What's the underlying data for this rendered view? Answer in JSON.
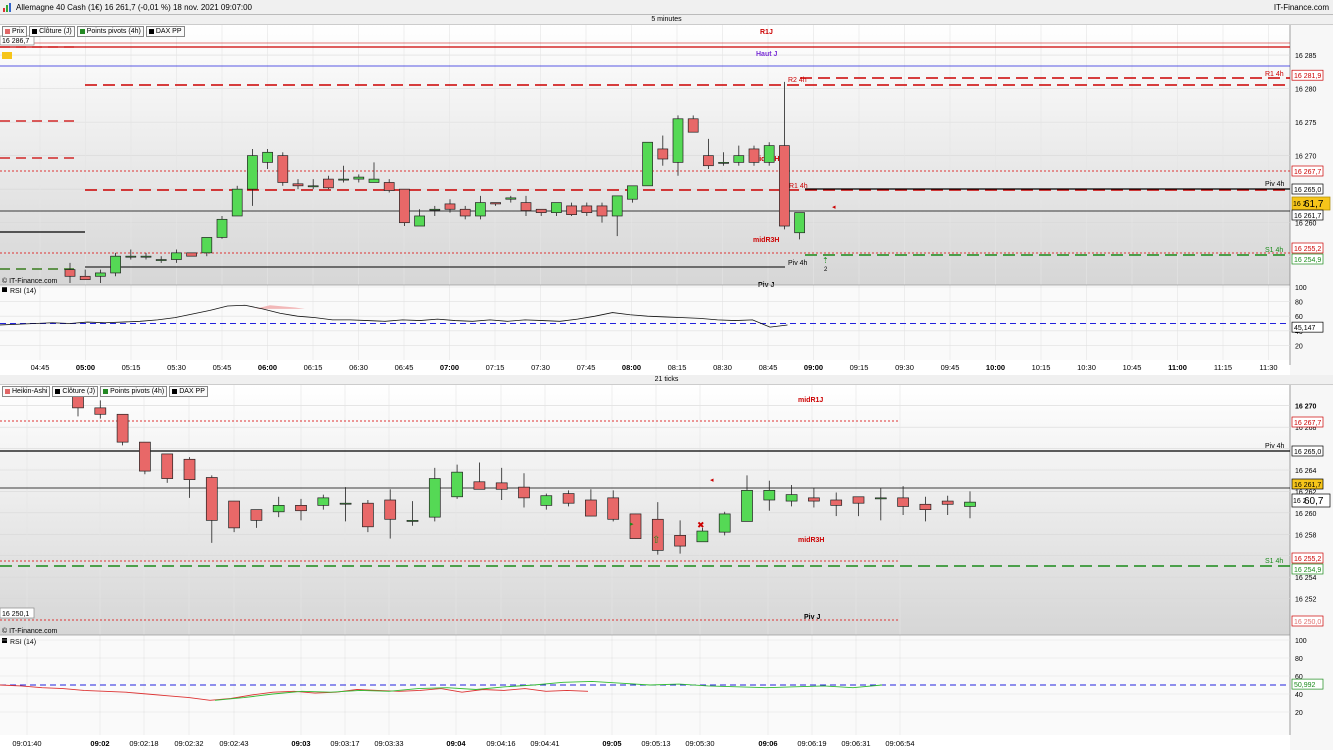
{
  "window": {
    "title": "Allemagne 40 Cash (1€) 16 261,7 (-0,01 %) 18 nov. 2021 09:07:00",
    "brand": "IT-Finance.com"
  },
  "colors": {
    "up": "#55d955",
    "down": "#e86868",
    "grid": "#d8d8d8",
    "red": "#cc0000",
    "green": "#1a8a1a",
    "blue": "#2222dd",
    "purple": "#7a2fd6",
    "highlight": "#f6c51a"
  },
  "top": {
    "interval": "5 minutes",
    "legend": [
      {
        "label": "Prix",
        "color": "#e06666"
      },
      {
        "label": "Clôture (J)",
        "color": "#000000"
      },
      {
        "label": "Points pivots (4h)",
        "color": "#228822"
      },
      {
        "label": "DAX PP",
        "color": "#000000"
      }
    ],
    "price_box": "16 286,7",
    "watermark": "© IT-Finance.com",
    "rsi_label": "RSI (14)",
    "rsi_value": "45,147",
    "price_axis": [
      "16 285",
      "16 280",
      "16 275",
      "16 270",
      "16 265",
      "16 260",
      "16 255"
    ],
    "rsi_axis": [
      "100",
      "80",
      "60",
      "40",
      "20"
    ],
    "time_axis": [
      "04:45",
      "05:00",
      "05:15",
      "05:30",
      "05:45",
      "06:00",
      "06:15",
      "06:30",
      "06:45",
      "07:00",
      "07:15",
      "07:30",
      "07:45",
      "08:00",
      "08:15",
      "08:30",
      "08:45",
      "09:00",
      "09:15",
      "09:30",
      "09:45",
      "10:00",
      "10:15",
      "10:30",
      "10:45",
      "11:00",
      "11:15",
      "11:30"
    ],
    "time_bold": [
      "05:00",
      "06:00",
      "07:00",
      "08:00",
      "09:00",
      "10:00",
      "11:00"
    ],
    "levels": {
      "r1j": "R1J",
      "haut_j": "Haut J",
      "r2_4h": "R2 4h",
      "r1_4h_l": "R1 4h",
      "r1_4h_r": "R1 4h",
      "midr1h": "midR1H",
      "midr3h": "midR3H",
      "piv_4h": "Piv 4h",
      "piv_4h_l": "Piv 4h",
      "piv_j": "Piv J",
      "s1_4h": "S1 4h"
    },
    "tags": {
      "t1": "16 281,9",
      "t2": "16 267,7",
      "t3": "16 265,0",
      "cur_small": "16 2",
      "cur_big": "61,7",
      "t5": "16 261,7",
      "t6": "16 255,2",
      "t7": "16 254,9"
    },
    "signal_count": "2"
  },
  "bottom": {
    "interval": "21 ticks",
    "legend": [
      {
        "label": "Heikin-Ashi",
        "color": "#e06666"
      },
      {
        "label": "Clôture (J)",
        "color": "#000000"
      },
      {
        "label": "Points pivots (4h)",
        "color": "#228822"
      },
      {
        "label": "DAX PP",
        "color": "#000000"
      }
    ],
    "price_box": "16 250,1",
    "watermark": "© IT-Finance.com",
    "rsi_label": "RSI (14)",
    "rsi_value": "50,992",
    "price_axis": [
      "16 270",
      "16 268",
      "16 266",
      "16 264",
      "16 262",
      "16 260",
      "16 258",
      "16 256",
      "16 254",
      "16 252"
    ],
    "rsi_axis": [
      "100",
      "80",
      "60",
      "40",
      "20"
    ],
    "time_axis": [
      "09:01:40",
      "09:02",
      "09:02:18",
      "09:02:32",
      "09:02:43",
      "09:03",
      "09:03:17",
      "09:03:33",
      "09:04",
      "09:04:16",
      "09:04:41",
      "09:05",
      "09:05:13",
      "09:05:30",
      "09:06",
      "09:06:19",
      "09:06:31",
      "09:06:54"
    ],
    "time_bold": [
      "09:02",
      "09:03",
      "09:04",
      "09:05",
      "09:06"
    ],
    "levels": {
      "midr1j": "midR1J",
      "piv_4h": "Piv 4h",
      "s1_4h": "S1 4h",
      "midr3h": "midR3H",
      "piv_j": "Piv J"
    },
    "tags": {
      "t1": "16 267,7",
      "t2": "16 265,0",
      "t3": "16 261,7",
      "cur_small": "16 2",
      "cur_big": "60,7",
      "t5": "16 255,2",
      "t6": "16 254,9",
      "t7": "16 250,0"
    }
  },
  "chart_data": [
    {
      "type": "candlestick",
      "title": "5 minutes",
      "ylim": [
        16251,
        16288
      ],
      "ohlc": [
        [
          16253,
          16254,
          16251,
          16252
        ],
        [
          16252,
          16253,
          16251.5,
          16251.5
        ],
        [
          16252,
          16253,
          16251,
          16252.5
        ],
        [
          16252.5,
          16255.5,
          16252,
          16255
        ],
        [
          16255,
          16256,
          16254.5,
          16255
        ],
        [
          16255,
          16255.5,
          16254.5,
          16255
        ],
        [
          16254.5,
          16255,
          16254,
          16254.5
        ],
        [
          16254.5,
          16256,
          16254,
          16255.5
        ],
        [
          16255.5,
          16255.5,
          16255,
          16255
        ],
        [
          16255.5,
          16257.8,
          16255,
          16257.8
        ],
        [
          16257.8,
          16261,
          16257.6,
          16260.5
        ],
        [
          16261,
          16265.5,
          16261,
          16265
        ],
        [
          16265,
          16271,
          16262.5,
          16270
        ],
        [
          16269,
          16271,
          16268,
          16270.5
        ],
        [
          16270,
          16270.5,
          16265.5,
          16266
        ],
        [
          16265.8,
          16266.5,
          16265,
          16265.5
        ],
        [
          16265.5,
          16266.5,
          16265,
          16265.5
        ],
        [
          16266.5,
          16267,
          16265,
          16265.2
        ],
        [
          16266.5,
          16268.5,
          16266,
          16266.5
        ],
        [
          16266.5,
          16267.2,
          16266,
          16266.8
        ],
        [
          16266,
          16269,
          16266,
          16266.5
        ],
        [
          16266,
          16266.5,
          16264.5,
          16264.8
        ],
        [
          16265,
          16265,
          16259.5,
          16260
        ],
        [
          16259.5,
          16262,
          16259.5,
          16261
        ],
        [
          16262,
          16262.5,
          16261,
          16262
        ],
        [
          16262.8,
          16263.5,
          16261.5,
          16262
        ],
        [
          16262,
          16262.5,
          16260.5,
          16261
        ],
        [
          16261,
          16264,
          16260.5,
          16263
        ],
        [
          16263,
          16263,
          16262.5,
          16262.8
        ],
        [
          16263.5,
          16264,
          16263,
          16263.7
        ],
        [
          16263,
          16264,
          16261,
          16261.8
        ],
        [
          16262,
          16262,
          16261,
          16261.5
        ],
        [
          16261.5,
          16262.8,
          16261,
          16263
        ],
        [
          16262.5,
          16263,
          16261,
          16261.2
        ],
        [
          16262.5,
          16263,
          16261,
          16261.5
        ],
        [
          16262.5,
          16263,
          16260,
          16261
        ],
        [
          16261,
          16264,
          16258,
          16264
        ],
        [
          16263.5,
          16265.5,
          16263,
          16265.5
        ],
        [
          16265.5,
          16272,
          16265.5,
          16272
        ],
        [
          16271,
          16273,
          16268.5,
          16269.5
        ],
        [
          16269,
          16276,
          16267,
          16275.5
        ],
        [
          16275.5,
          16276,
          16273.5,
          16273.5
        ],
        [
          16270,
          16272.5,
          16268,
          16268.5
        ],
        [
          16269,
          16270.5,
          16268.5,
          16269
        ],
        [
          16269,
          16271.5,
          16268.5,
          16270
        ],
        [
          16271,
          16271.5,
          16268.5,
          16269
        ],
        [
          16269,
          16272,
          16268.5,
          16271.5
        ],
        [
          16271.5,
          16281,
          16259,
          16259.5
        ],
        [
          16258.5,
          16261.5,
          16257.5,
          16261.5
        ]
      ]
    },
    {
      "type": "candlestick",
      "title": "21 ticks",
      "ylim": [
        16250,
        16271
      ],
      "ohlc": [
        [
          16271,
          16271,
          16269,
          16269.8
        ],
        [
          16269.8,
          16270.5,
          16268.8,
          16269.2
        ],
        [
          16269.2,
          16269.2,
          16266.3,
          16266.6
        ],
        [
          16266.6,
          16266.6,
          16263.6,
          16263.9
        ],
        [
          16265.5,
          16265.5,
          16262.8,
          16263.2
        ],
        [
          16265,
          16265.2,
          16261.4,
          16263.1
        ],
        [
          16263.3,
          16263.5,
          16257.2,
          16259.3
        ],
        [
          16261.1,
          16261.1,
          16258.2,
          16258.6
        ],
        [
          16260.3,
          16260.3,
          16258.6,
          16259.3
        ],
        [
          16260.1,
          16261.5,
          16259.6,
          16260.7
        ],
        [
          16260.7,
          16261.3,
          16259.3,
          16260.2
        ],
        [
          16260.7,
          16261.7,
          16260.3,
          16261.4
        ],
        [
          16260.9,
          16262.4,
          16259.2,
          16260.9
        ],
        [
          16260.9,
          16261.2,
          16258.2,
          16258.7
        ],
        [
          16261.2,
          16262.2,
          16257.6,
          16259.4
        ],
        [
          16259.2,
          16261.1,
          16258.8,
          16259.3
        ],
        [
          16259.6,
          16264.2,
          16259.2,
          16263.2
        ],
        [
          16261.5,
          16264.5,
          16261.3,
          16263.8
        ],
        [
          16262.9,
          16264.7,
          16262.6,
          16262.2
        ],
        [
          16262.8,
          16264.2,
          16261.2,
          16262.2
        ],
        [
          16262.4,
          16263.7,
          16260.5,
          16261.4
        ],
        [
          16260.7,
          16261.8,
          16260.3,
          16261.6
        ],
        [
          16261.8,
          16262.1,
          16260.6,
          16260.9
        ],
        [
          16261.2,
          16262.2,
          16259.7,
          16259.7
        ],
        [
          16261.4,
          16262.1,
          16259.2,
          16259.4
        ],
        [
          16259.9,
          16259.9,
          16257.6,
          16257.6
        ],
        [
          16259.4,
          16261,
          16256.1,
          16256.5
        ],
        [
          16257.9,
          16259.3,
          16256.2,
          16256.9
        ],
        [
          16257.3,
          16258.6,
          16257.3,
          16258.3
        ],
        [
          16258.2,
          16260.1,
          16257.9,
          16259.9
        ],
        [
          16259.2,
          16263.5,
          16259.2,
          16262.1
        ],
        [
          16261.2,
          16263,
          16260.2,
          16262.1
        ],
        [
          16261.1,
          16262.6,
          16260.6,
          16261.7
        ],
        [
          16261.4,
          16262.3,
          16260.5,
          16261.1
        ],
        [
          16261.2,
          16261.9,
          16259.7,
          16260.7
        ],
        [
          16261.5,
          16261.5,
          16259.7,
          16260.9
        ],
        [
          16261.4,
          16262.3,
          16259.3,
          16261.4
        ],
        [
          16261.4,
          16262.5,
          16259.8,
          16260.6
        ],
        [
          16260.8,
          16261.5,
          16259.2,
          16260.3
        ],
        [
          16261.1,
          16261.6,
          16259.8,
          16260.8
        ],
        [
          16260.6,
          16262,
          16259.5,
          16261
        ]
      ]
    }
  ]
}
